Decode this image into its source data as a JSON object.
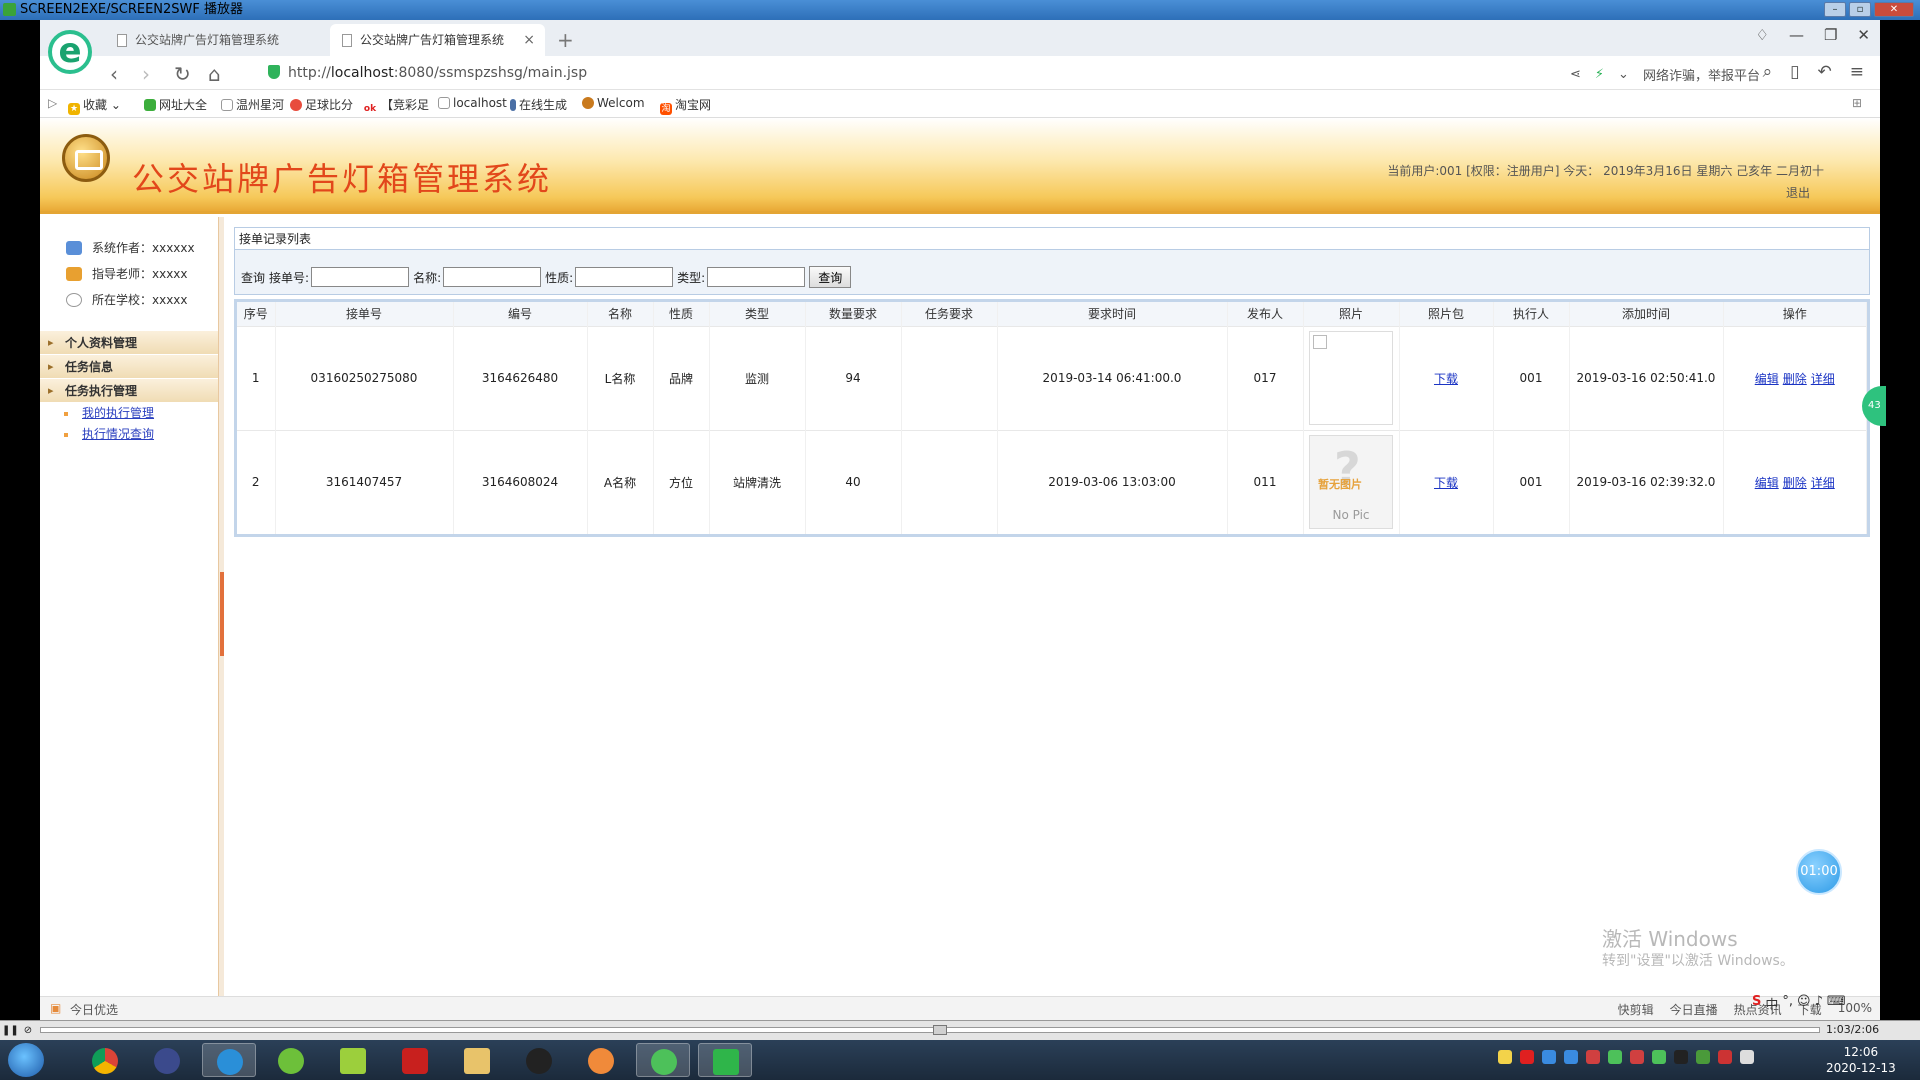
{
  "player": {
    "title": "SCREEN2EXE/SCREEN2SWF 播放器",
    "time": "1:03/2:06"
  },
  "browser": {
    "tabs": [
      {
        "label": "公交站牌广告灯箱管理系统"
      },
      {
        "label": "公交站牌广告灯箱管理系统"
      }
    ],
    "url_prefix": "http://",
    "url_host": "localhost",
    "url_rest": ":8080/ssmspzshsg/main.jsp",
    "report_text": "网络诈骗，举报平台",
    "bookmarks": [
      {
        "label": "收藏",
        "color": "#f0b400"
      },
      {
        "label": "网址大全",
        "color": "#3cae3c"
      },
      {
        "label": "温州星河",
        "color": "#999999"
      },
      {
        "label": "足球比分",
        "color": "#e84c3d"
      },
      {
        "label": "【竞彩足",
        "color": "#e02020"
      },
      {
        "label": "localhost",
        "color": "#999999"
      },
      {
        "label": "在线生成",
        "color": "#4a6fa5"
      },
      {
        "label": "Welcom",
        "color": "#c97a1e"
      },
      {
        "label": "淘宝网",
        "color": "#ff5000"
      }
    ],
    "status_left": "今日优选",
    "status_right": [
      "快剪辑",
      "今日直播",
      "热点资讯",
      "下载",
      "100%"
    ]
  },
  "app": {
    "title": "公交站牌广告灯箱管理系统",
    "user_info": "当前用户:001 [权限：注册用户] 今天：  2019年3月16日 星期六 己亥年 二月初十",
    "logout": "退出"
  },
  "sidebar": {
    "info": [
      {
        "label": "系统作者：xxxxxx",
        "color": "#5a8fd8"
      },
      {
        "label": "指导老师：xxxxx",
        "color": "#e8a030"
      },
      {
        "label": "所在学校：xxxxx",
        "color": "#999999"
      }
    ],
    "menu": {
      "personal": "个人资料管理",
      "task_info": "任务信息",
      "task_exec": "任务执行管理",
      "my_exec": "我的执行管理",
      "exec_query": "执行情况查询"
    }
  },
  "main": {
    "panel_title": "接单记录列表",
    "search": {
      "prefix": "查询",
      "order_no": "接单号:",
      "name": "名称:",
      "nature": "性质:",
      "type": "类型:",
      "button": "查询"
    },
    "columns": [
      "序号",
      "接单号",
      "编号",
      "名称",
      "性质",
      "类型",
      "数量要求",
      "任务要求",
      "要求时间",
      "发布人",
      "照片",
      "照片包",
      "执行人",
      "添加时间",
      "操作"
    ],
    "rows": [
      {
        "seq": "1",
        "order_no": "03160250275080",
        "code": "3164626480",
        "name": "L名称",
        "nature": "品牌",
        "type": "监测",
        "qty": "94",
        "task_req": "",
        "req_time": "2019-03-14 06:41:00.0",
        "publisher": "017",
        "pkg": "下载",
        "executor": "001",
        "added": "2019-03-16 02:50:41.0",
        "edit": "编辑",
        "delete": "删除",
        "detail": "详细"
      },
      {
        "seq": "2",
        "order_no": "3161407457",
        "code": "3164608024",
        "name": "A名称",
        "nature": "方位",
        "type": "站牌清洗",
        "qty": "40",
        "task_req": "",
        "req_time": "2019-03-06 13:03:00",
        "publisher": "011",
        "pkg": "下载",
        "executor": "001",
        "added": "2019-03-16 02:39:32.0",
        "edit": "编辑",
        "delete": "删除",
        "detail": "详细"
      }
    ],
    "nopic_cn": "暂无图片",
    "nopic_en": "No Pic"
  },
  "overlay": {
    "timer": "01:00",
    "side_badge": "43",
    "watermark_title": "激活 Windows",
    "watermark_sub": "转到\"设置\"以激活 Windows。"
  },
  "taskbar": {
    "clock_time": "12:06",
    "clock_date": "2020-12-13",
    "ime": "中"
  }
}
